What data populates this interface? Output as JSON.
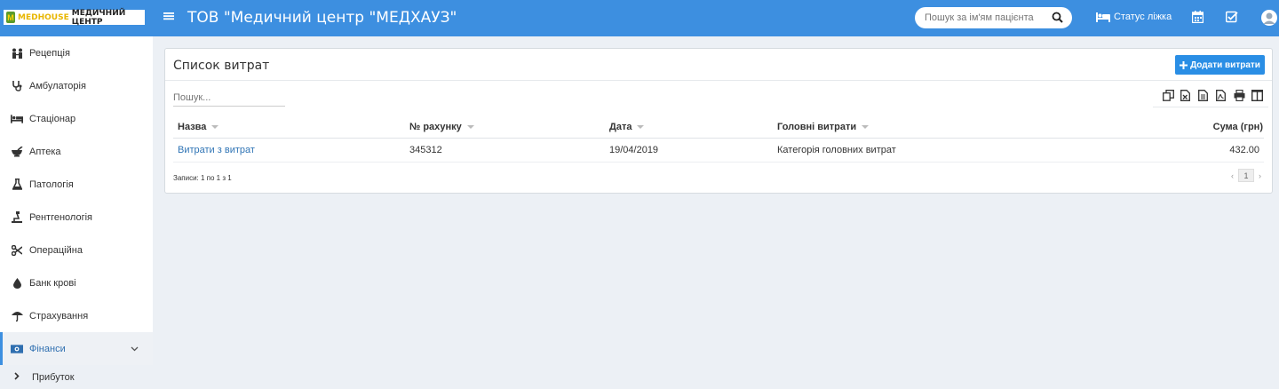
{
  "header": {
    "logo_brand": "MEDHOUSE",
    "logo_text": "МЕДИЧНИЙ ЦЕНТР",
    "org_title": "ТОВ \"Медичний центр \"МЕДХАУЗ\"",
    "search_placeholder": "Пошук за ім'ям пацієнта",
    "bed_status_label": "Статус ліжка",
    "accent_color": "#3d8fe0"
  },
  "sidebar": {
    "items": [
      {
        "label": "Рецепція",
        "icon": "reception-icon"
      },
      {
        "label": "Амбулаторія",
        "icon": "stethoscope-icon"
      },
      {
        "label": "Стаціонар",
        "icon": "bed-icon"
      },
      {
        "label": "Аптека",
        "icon": "mortar-icon"
      },
      {
        "label": "Патологія",
        "icon": "flask-icon"
      },
      {
        "label": "Рентгенологія",
        "icon": "xray-icon"
      },
      {
        "label": "Операційна",
        "icon": "scissors-icon"
      },
      {
        "label": "Банк крові",
        "icon": "drop-icon"
      },
      {
        "label": "Страхування",
        "icon": "umbrella-icon"
      },
      {
        "label": "Фінанси",
        "icon": "money-icon",
        "active": true
      }
    ],
    "sub_items": [
      {
        "label": "Прибуток",
        "icon": "chevron-right-icon"
      }
    ]
  },
  "main": {
    "title": "Список витрат",
    "add_button_label": "Додати витрати",
    "search_placeholder": "Пошук...",
    "columns": [
      "Назва",
      "№ рахунку",
      "Дата",
      "Головні витрати",
      "Сума (грн)"
    ],
    "rows": [
      {
        "name": "Витрати з витрат",
        "invoice": "345312",
        "date": "19/04/2019",
        "category": "Категорія головних витрат",
        "amount": "432.00"
      }
    ],
    "records_info": "Записи: 1 по 1 з 1",
    "current_page": "1",
    "prev_label": "‹",
    "next_label": "›"
  }
}
